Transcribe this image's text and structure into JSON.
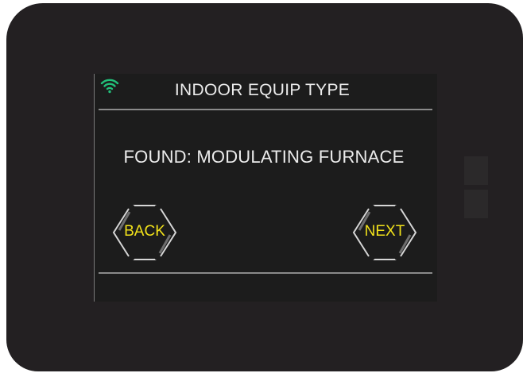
{
  "screen": {
    "title": "INDOOR EQUIP TYPE",
    "message": "FOUND: MODULATING FURNACE"
  },
  "buttons": {
    "back_label": "BACK",
    "next_label": "NEXT"
  },
  "icons": {
    "status": "wifi-icon"
  },
  "colors": {
    "bezel": "#232022",
    "screen": "#1c1c1c",
    "text": "#ececec",
    "button_label": "#f2e21a",
    "wifi": "#22c07a",
    "divider": "#8a8a8a"
  }
}
